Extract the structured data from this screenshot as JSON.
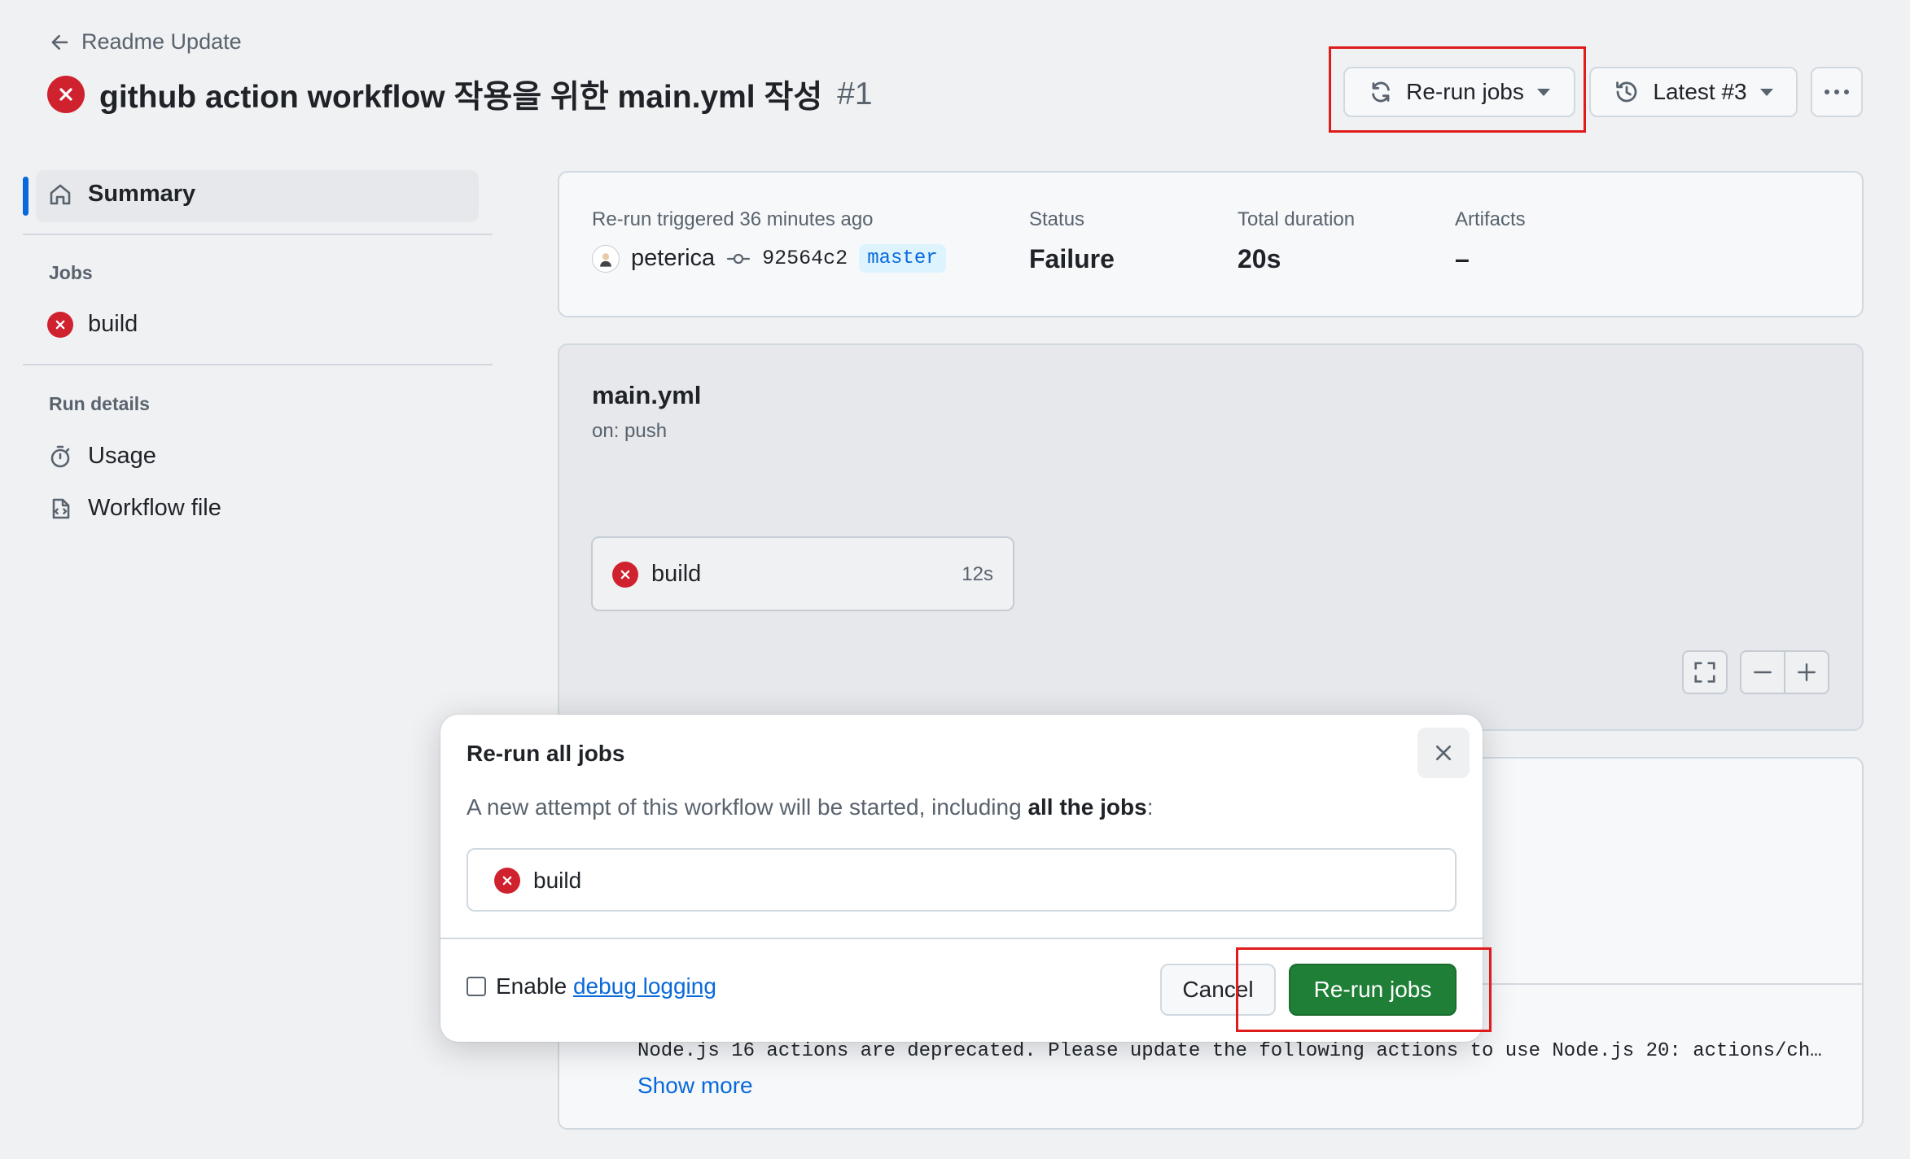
{
  "header": {
    "back_label": "Readme Update",
    "title": "github action workflow 작용을 위한 main.yml 작성",
    "run_number": "#1",
    "rerun_button": "Re-run jobs",
    "latest_button": "Latest #3"
  },
  "sidebar": {
    "summary": "Summary",
    "jobs_heading": "Jobs",
    "job": "build",
    "run_details_heading": "Run details",
    "usage": "Usage",
    "workflow_file": "Workflow file"
  },
  "summary": {
    "trigger_label": "Re-run triggered 36 minutes ago",
    "user": "peterica",
    "commit": "92564c2",
    "branch": "master",
    "status_label": "Status",
    "status_value": "Failure",
    "duration_label": "Total duration",
    "duration_value": "20s",
    "artifacts_label": "Artifacts",
    "artifacts_value": "–"
  },
  "graph": {
    "file": "main.yml",
    "trigger": "on: push",
    "job": "build",
    "job_duration": "12s"
  },
  "annotations": {
    "warning_text": "Node.js 16 actions are deprecated. Please update the following actions to use Node.js 20: actions/ch…",
    "show_more": "Show more"
  },
  "modal": {
    "title": "Re-run all jobs",
    "desc_prefix": "A new attempt of this workflow will be started, including ",
    "desc_bold": "all the jobs",
    "desc_suffix": ":",
    "job": "build",
    "enable_label": "Enable ",
    "debug_link": "debug logging",
    "cancel": "Cancel",
    "confirm": "Re-run jobs"
  },
  "colors": {
    "accent": "#0969da",
    "danger": "#cf222e",
    "primary_button": "#1f7f37",
    "highlight_box": "#e01b1b"
  }
}
